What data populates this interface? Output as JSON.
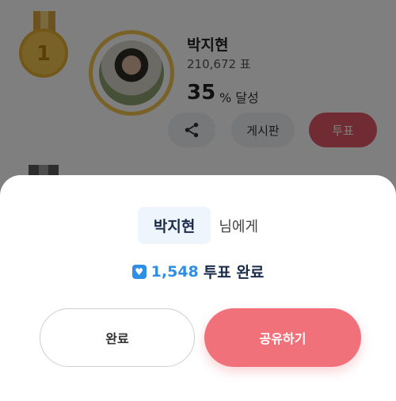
{
  "rank_card": {
    "rank": "1",
    "name": "박지현",
    "votes": "210,672 표",
    "percent": "35",
    "percent_suffix": "% 달성",
    "board_label": "게시판",
    "vote_label": "투표"
  },
  "dialog": {
    "name": "박지현",
    "name_suffix": "님에게",
    "count": "1,548",
    "result_text": "투표 완료",
    "done_label": "완료",
    "share_label": "공유하기"
  },
  "colors": {
    "accent_blue": "#2f8ee5",
    "accent_pink": "#f07179",
    "gold": "#f2c54e"
  }
}
